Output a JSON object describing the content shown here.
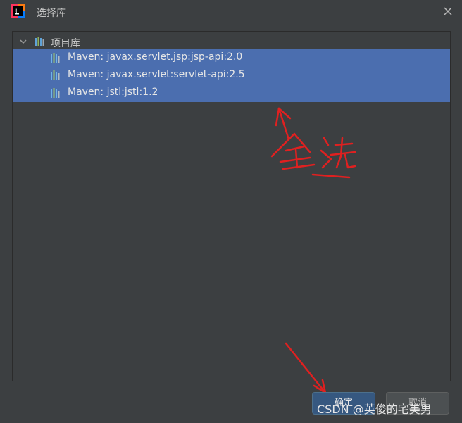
{
  "window": {
    "title": "选择库"
  },
  "tree": {
    "root_label": "项目库",
    "libraries": [
      {
        "label": "Maven: javax.servlet.jsp:jsp-api:2.0"
      },
      {
        "label": "Maven: javax.servlet:servlet-api:2.5"
      },
      {
        "label": "Maven: jstl:jstl:1.2"
      }
    ]
  },
  "annotation": {
    "text": "全选"
  },
  "buttons": {
    "ok_label": "确定",
    "cancel_label": "取消"
  },
  "watermark": "CSDN @英俊的宅美男",
  "colors": {
    "selection": "#4b6eaf",
    "background": "#3c3f41",
    "annotation": "#e02020"
  },
  "icons": [
    "intellij-app-icon",
    "close-icon",
    "chevron-down-icon",
    "library-icon"
  ]
}
